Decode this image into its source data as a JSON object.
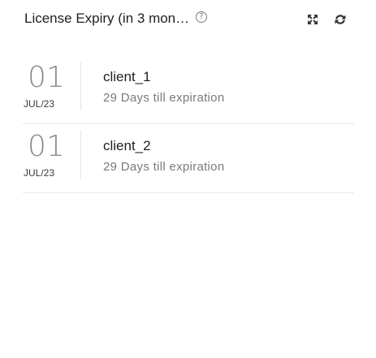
{
  "widget": {
    "title": "License Expiry (in 3 mon…",
    "help_glyph": "?",
    "icons": {
      "help": "question-circle-icon",
      "expand": "expand-icon",
      "refresh": "refresh-icon"
    },
    "colors": {
      "day_number": "#8a8a8a",
      "subtext": "#7a7a7a",
      "divider": "#e8e8e8"
    }
  },
  "licenses": [
    {
      "day": "01",
      "month_year": "JUL/23",
      "client": "client_1",
      "expiry_text": "29 Days till expiration"
    },
    {
      "day": "01",
      "month_year": "JUL/23",
      "client": "client_2",
      "expiry_text": "29 Days till expiration"
    }
  ]
}
